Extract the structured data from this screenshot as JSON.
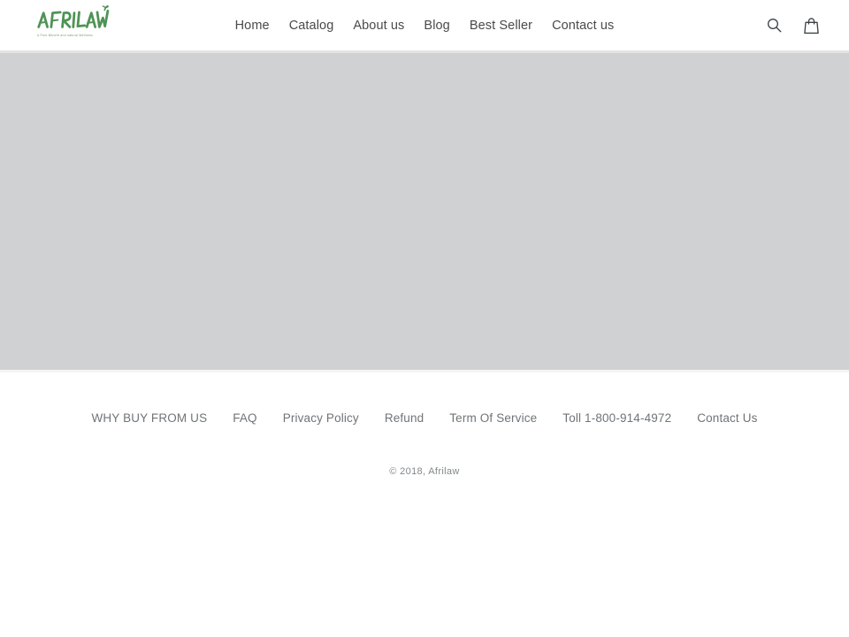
{
  "header": {
    "logo": {
      "name": "AFRILAW",
      "tagline": "A Pure Benefit and natural Wellness",
      "color": "#4f9355"
    },
    "nav": {
      "items": [
        {
          "label": "Home"
        },
        {
          "label": "Catalog"
        },
        {
          "label": "About us"
        },
        {
          "label": "Blog"
        },
        {
          "label": "Best Seller"
        },
        {
          "label": "Contact us"
        }
      ]
    },
    "icons": [
      {
        "name": "search-icon",
        "label": "Search"
      },
      {
        "name": "cart-icon",
        "label": "Cart"
      }
    ]
  },
  "main": {
    "content_block": {
      "background_color": "#d0d1d3",
      "text": ""
    }
  },
  "footer": {
    "links": [
      {
        "label": "WHY BUY FROM US"
      },
      {
        "label": "FAQ"
      },
      {
        "label": "Privacy Policy"
      },
      {
        "label": "Refund"
      },
      {
        "label": "Term Of Service"
      },
      {
        "label": "Toll 1-800-914-4972"
      },
      {
        "label": "Contact Us"
      }
    ],
    "copyright": "© 2018, Afrilaw"
  }
}
